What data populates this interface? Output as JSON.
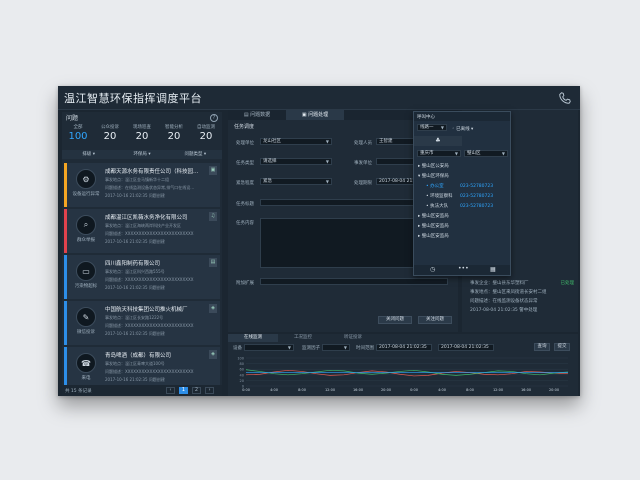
{
  "app": {
    "title": "温江智慧环保指挥调度平台"
  },
  "left": {
    "header": "问题",
    "stats": [
      {
        "label": "全部",
        "value": "100",
        "blue": true
      },
      {
        "label": "公众投诉",
        "value": "20"
      },
      {
        "label": "现场巡查",
        "value": "20"
      },
      {
        "label": "智能分析",
        "value": "20"
      },
      {
        "label": "自动监测",
        "value": "20"
      }
    ],
    "filters": [
      "排级",
      "环保局",
      "问题类型"
    ],
    "cards": [
      {
        "color": "#f5a623",
        "icon": "cluster",
        "caption": "设备运行异常",
        "title": "成都天源水务有限责任公司（科技园…",
        "d1": "事发地点：温江区金马镇新华十二组",
        "d2": "问题描述：在线监测设备状态异常,排气口在线设…",
        "d3": "2017-10-16 21:02:35  问题创建",
        "tag": "▣"
      },
      {
        "color": "#e0424d",
        "icon": "search",
        "caption": "群众举报",
        "title": "成都温江区凯薇水务净化有限公司",
        "d1": "事发地点：温江区海峡两岸科技产业开发区",
        "d2": "问题描述：XXXXXXXXXXXXXXXXXXXXXXXXX",
        "d3": "2017-10-16 21:02:35  问题创建",
        "tag": "♫"
      },
      {
        "color": "#2d8ee8",
        "icon": "monitor",
        "caption": "污染物超标",
        "title": "四川鑫阳制药有限公司",
        "d1": "事发地点：温江区科兴西路555号",
        "d2": "问题描述：XXXXXXXXXXXXXXXXXXXXXXXXX",
        "d3": "2017-10-16 21:02:35  问题创建",
        "tag": "▤"
      },
      {
        "color": "#2d8ee8",
        "icon": "doc",
        "caption": "微信投诉",
        "title": "中国航天科技集团公司推火机械厂",
        "d1": "事发地点：温江区长安路1222号",
        "d2": "问题描述：XXXXXXXXXXXXXXXXXXXXXXXXX",
        "d3": "2017-10-16 21:02:35  问题创建",
        "tag": "◈"
      },
      {
        "color": "#2d8ee8",
        "icon": "phone",
        "caption": "来电",
        "title": "青岛啤酒（成都）有限公司",
        "d1": "事发地点：温江区青啤大道100号",
        "d2": "问题描述：XXXXXXXXXXXXXXXXXXXXXXXXX",
        "d3": "2017-10-16 21:02:35  问题创建",
        "tag": "◈"
      }
    ],
    "pager": {
      "total": "共 15 条记录",
      "pages": [
        "‹",
        "1",
        "2",
        "›"
      ]
    }
  },
  "middle": {
    "tabs": [
      "问题数据",
      "问题处理"
    ],
    "section": "任务调度",
    "fields": {
      "unit_label": "处理单位",
      "unit_value": "龙山社区",
      "person_label": "处理人员",
      "person_value": "王智建",
      "type_label": "任务类型",
      "type_value": "请选择",
      "event_label": "事发单位",
      "event_value": "",
      "urgency_label": "紧急程度",
      "urgency_value": "紧急",
      "deadline_label": "处理期限",
      "deadline_value": "2017-08-04 21:02:35",
      "tasktitle_label": "任务标题",
      "content_label": "任务内容",
      "attach_label": "附加扩展"
    },
    "buttons": [
      "关闭问题",
      "关注问题"
    ]
  },
  "contacts": {
    "title": "呼叫中心",
    "search": "线路一",
    "status": "已离线",
    "city": "重庆市",
    "district": "璧山区",
    "tree": [
      {
        "label": "璧山区公安局",
        "indent": 0,
        "expand": "▸"
      },
      {
        "label": "璧山区环保局",
        "indent": 0,
        "expand": "▾"
      },
      {
        "label": "办公室",
        "indent": 1,
        "tel": "023-52780723",
        "blue": true
      },
      {
        "label": "环境监察科",
        "indent": 1,
        "tel": "023-52780723"
      },
      {
        "label": "执法大队",
        "indent": 1,
        "tel": "023-52780723"
      },
      {
        "label": "璧山区安监局",
        "indent": 0,
        "expand": "▸"
      },
      {
        "label": "璧山区安监局",
        "indent": 0,
        "expand": "▸"
      },
      {
        "label": "璧山区安监局",
        "indent": 0,
        "expand": "▸"
      }
    ]
  },
  "right_record": {
    "line1": "事发企业：璧山县东华塑料厂",
    "line1_status": "已处理",
    "line2": "事发地点：璧山区来凤街道长安村二组",
    "line3": "问题描述：在线监测设备状态异常",
    "line4": "2017-08-04 21:02:35  警中处理"
  },
  "bottom": {
    "tabs": [
      "在线监测",
      "工况监控",
      "听证投诉"
    ],
    "device_label": "设备",
    "factor_label": "监测因子",
    "time_label": "时间范围",
    "time_from": "2017-08-04 21:02:35",
    "time_to": "2017-08-04 21:02:35",
    "btn_query": "查询",
    "btn_submit": "提交"
  },
  "chart_data": {
    "type": "line",
    "x": [
      "0:00",
      "2:00",
      "4:00",
      "6:00",
      "8:00",
      "10:00",
      "12:00",
      "14:00",
      "16:00",
      "18:00",
      "20:00",
      "22:00",
      "0:00",
      "2:00",
      "4:00",
      "6:00",
      "8:00",
      "10:00",
      "12:00",
      "14:00",
      "16:00",
      "18:00",
      "20:00",
      "22:00"
    ],
    "yticks": [
      "100",
      "80",
      "60",
      "40",
      "20",
      "0"
    ],
    "ylim": [
      0,
      100
    ],
    "series": [
      {
        "color": "#e45a4f",
        "values": [
          40,
          42,
          50,
          56,
          52,
          44,
          38,
          40,
          48,
          54,
          50,
          42,
          36,
          38,
          46,
          52,
          48,
          42,
          40,
          44,
          52,
          50,
          46,
          44
        ]
      },
      {
        "color": "#3fb86a",
        "values": [
          58,
          52,
          44,
          40,
          44,
          50,
          56,
          54,
          46,
          42,
          46,
          52,
          56,
          50,
          42,
          38,
          42,
          48,
          54,
          52,
          44,
          40,
          46,
          50
        ]
      },
      {
        "color": "#2fa6ff",
        "values": [
          48,
          48,
          48,
          48,
          48,
          48,
          48,
          48,
          48,
          48,
          48,
          48,
          48,
          48,
          48,
          48,
          48,
          48,
          48,
          48,
          48,
          48,
          48,
          48
        ]
      }
    ]
  }
}
